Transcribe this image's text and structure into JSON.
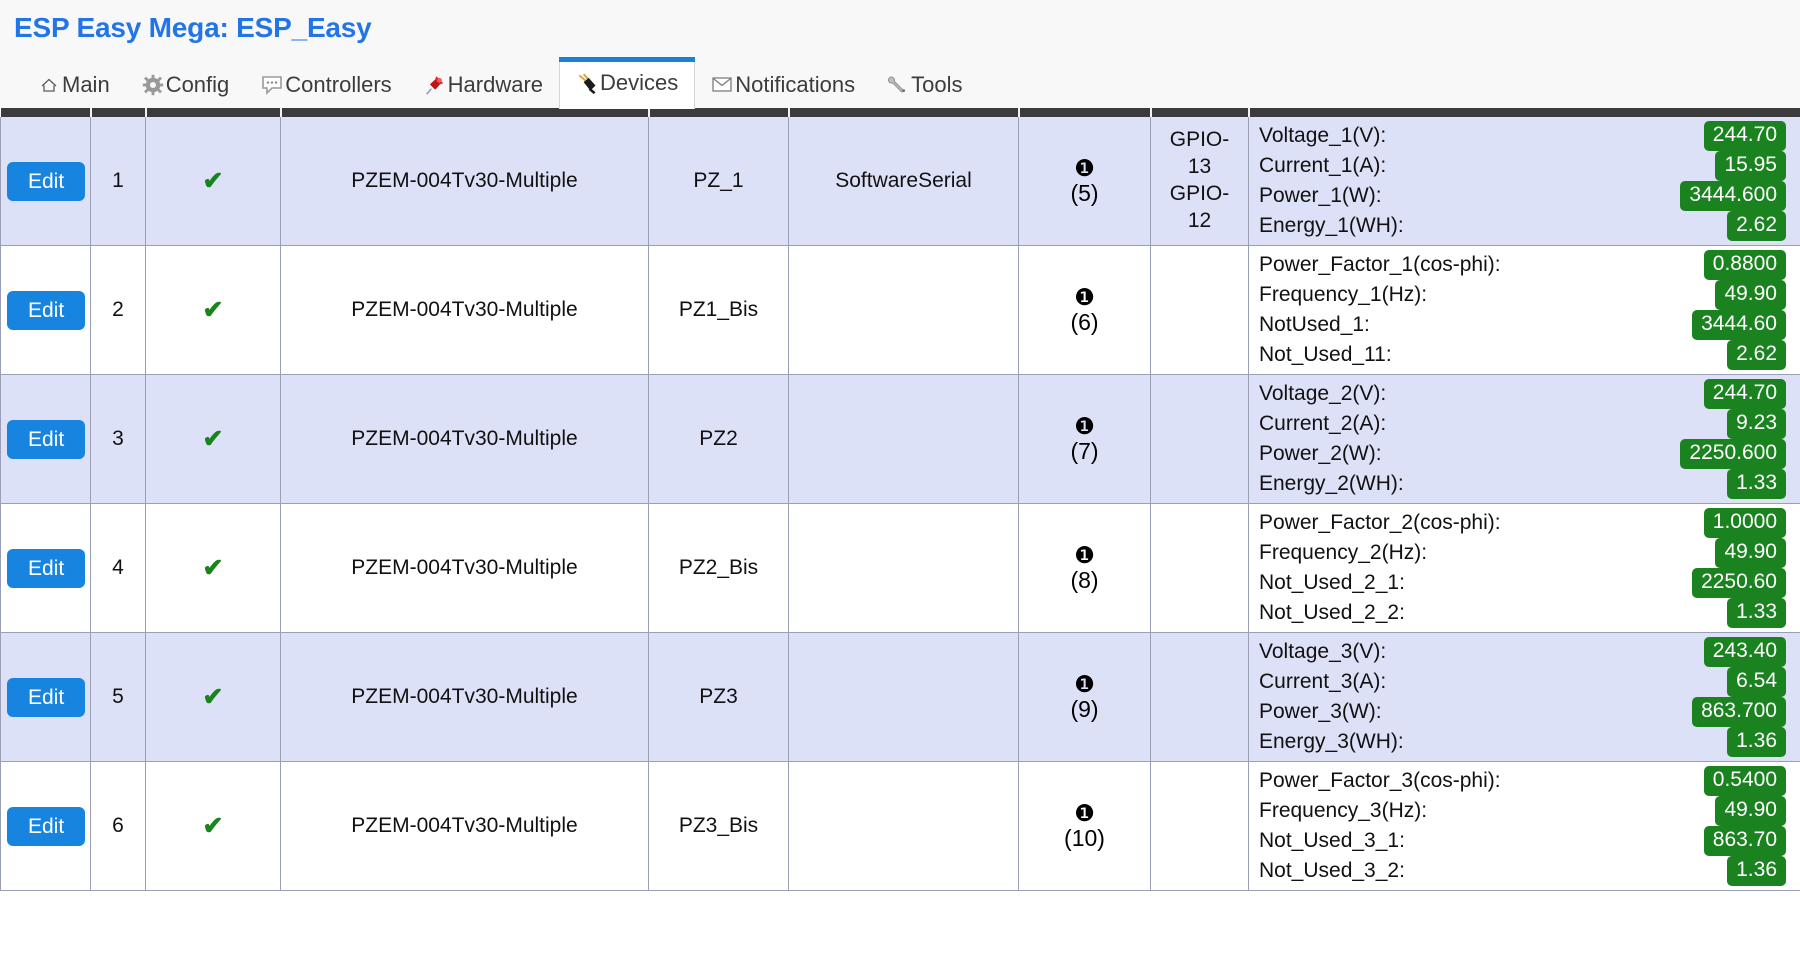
{
  "header": {
    "title": "ESP Easy Mega: ESP_Easy"
  },
  "tabs": [
    {
      "label": "Main",
      "icon": "home-icon",
      "active": false
    },
    {
      "label": "Config",
      "icon": "gear-icon",
      "active": false
    },
    {
      "label": "Controllers",
      "icon": "speech-bubble-icon",
      "active": false
    },
    {
      "label": "Hardware",
      "icon": "pushpin-icon",
      "active": false
    },
    {
      "label": "Devices",
      "icon": "plug-icon",
      "active": true
    },
    {
      "label": "Notifications",
      "icon": "envelope-icon",
      "active": false
    },
    {
      "label": "Tools",
      "icon": "wrench-icon",
      "active": false
    }
  ],
  "colors": {
    "accent": "#2175e8",
    "tab_active_top": "#1782d8",
    "edit_button": "#1785e0",
    "value_badge": "#1b8220",
    "check": "#17841c",
    "row_odd": "#dde1f7",
    "header_bar": "#3b3b3b"
  },
  "table": {
    "edit_label": "Edit",
    "enabled_mark": "✔",
    "rows": [
      {
        "nr": "1",
        "enabled": "✔",
        "device": "PZEM-004Tv30-Multiple",
        "name": "PZ_1",
        "port": "SoftwareSerial",
        "ctr_icon": "❶",
        "ctr_idx": "(5)",
        "gpio": "GPIO-13 GPIO-12",
        "gpio_lines": [
          "GPIO-",
          "13",
          "GPIO-",
          "12"
        ],
        "values": [
          {
            "label": "Voltage_1(V):",
            "value": "244.70"
          },
          {
            "label": "Current_1(A):",
            "value": "15.95"
          },
          {
            "label": "Power_1(W):",
            "value": "3444.600"
          },
          {
            "label": "Energy_1(WH):",
            "value": "2.62"
          }
        ]
      },
      {
        "nr": "2",
        "enabled": "✔",
        "device": "PZEM-004Tv30-Multiple",
        "name": "PZ1_Bis",
        "port": "",
        "ctr_icon": "❶",
        "ctr_idx": "(6)",
        "gpio": "",
        "gpio_lines": [],
        "values": [
          {
            "label": "Power_Factor_1(cos-phi):",
            "value": "0.8800"
          },
          {
            "label": "Frequency_1(Hz):",
            "value": "49.90"
          },
          {
            "label": "NotUsed_1:",
            "value": "3444.60"
          },
          {
            "label": "Not_Used_11:",
            "value": "2.62"
          }
        ]
      },
      {
        "nr": "3",
        "enabled": "✔",
        "device": "PZEM-004Tv30-Multiple",
        "name": "PZ2",
        "port": "",
        "ctr_icon": "❶",
        "ctr_idx": "(7)",
        "gpio": "",
        "gpio_lines": [],
        "values": [
          {
            "label": "Voltage_2(V):",
            "value": "244.70"
          },
          {
            "label": "Current_2(A):",
            "value": "9.23"
          },
          {
            "label": "Power_2(W):",
            "value": "2250.600"
          },
          {
            "label": "Energy_2(WH):",
            "value": "1.33"
          }
        ]
      },
      {
        "nr": "4",
        "enabled": "✔",
        "device": "PZEM-004Tv30-Multiple",
        "name": "PZ2_Bis",
        "port": "",
        "ctr_icon": "❶",
        "ctr_idx": "(8)",
        "gpio": "",
        "gpio_lines": [],
        "values": [
          {
            "label": "Power_Factor_2(cos-phi):",
            "value": "1.0000"
          },
          {
            "label": "Frequency_2(Hz):",
            "value": "49.90"
          },
          {
            "label": "Not_Used_2_1:",
            "value": "2250.60"
          },
          {
            "label": "Not_Used_2_2:",
            "value": "1.33"
          }
        ]
      },
      {
        "nr": "5",
        "enabled": "✔",
        "device": "PZEM-004Tv30-Multiple",
        "name": "PZ3",
        "port": "",
        "ctr_icon": "❶",
        "ctr_idx": "(9)",
        "gpio": "",
        "gpio_lines": [],
        "values": [
          {
            "label": "Voltage_3(V):",
            "value": "243.40"
          },
          {
            "label": "Current_3(A):",
            "value": "6.54"
          },
          {
            "label": "Power_3(W):",
            "value": "863.700"
          },
          {
            "label": "Energy_3(WH):",
            "value": "1.36"
          }
        ]
      },
      {
        "nr": "6",
        "enabled": "✔",
        "device": "PZEM-004Tv30-Multiple",
        "name": "PZ3_Bis",
        "port": "",
        "ctr_icon": "❶",
        "ctr_idx": "(10)",
        "gpio": "",
        "gpio_lines": [],
        "values": [
          {
            "label": "Power_Factor_3(cos-phi):",
            "value": "0.5400"
          },
          {
            "label": "Frequency_3(Hz):",
            "value": "49.90"
          },
          {
            "label": "Not_Used_3_1:",
            "value": "863.70"
          },
          {
            "label": "Not_Used_3_2:",
            "value": "1.36"
          }
        ]
      }
    ]
  }
}
